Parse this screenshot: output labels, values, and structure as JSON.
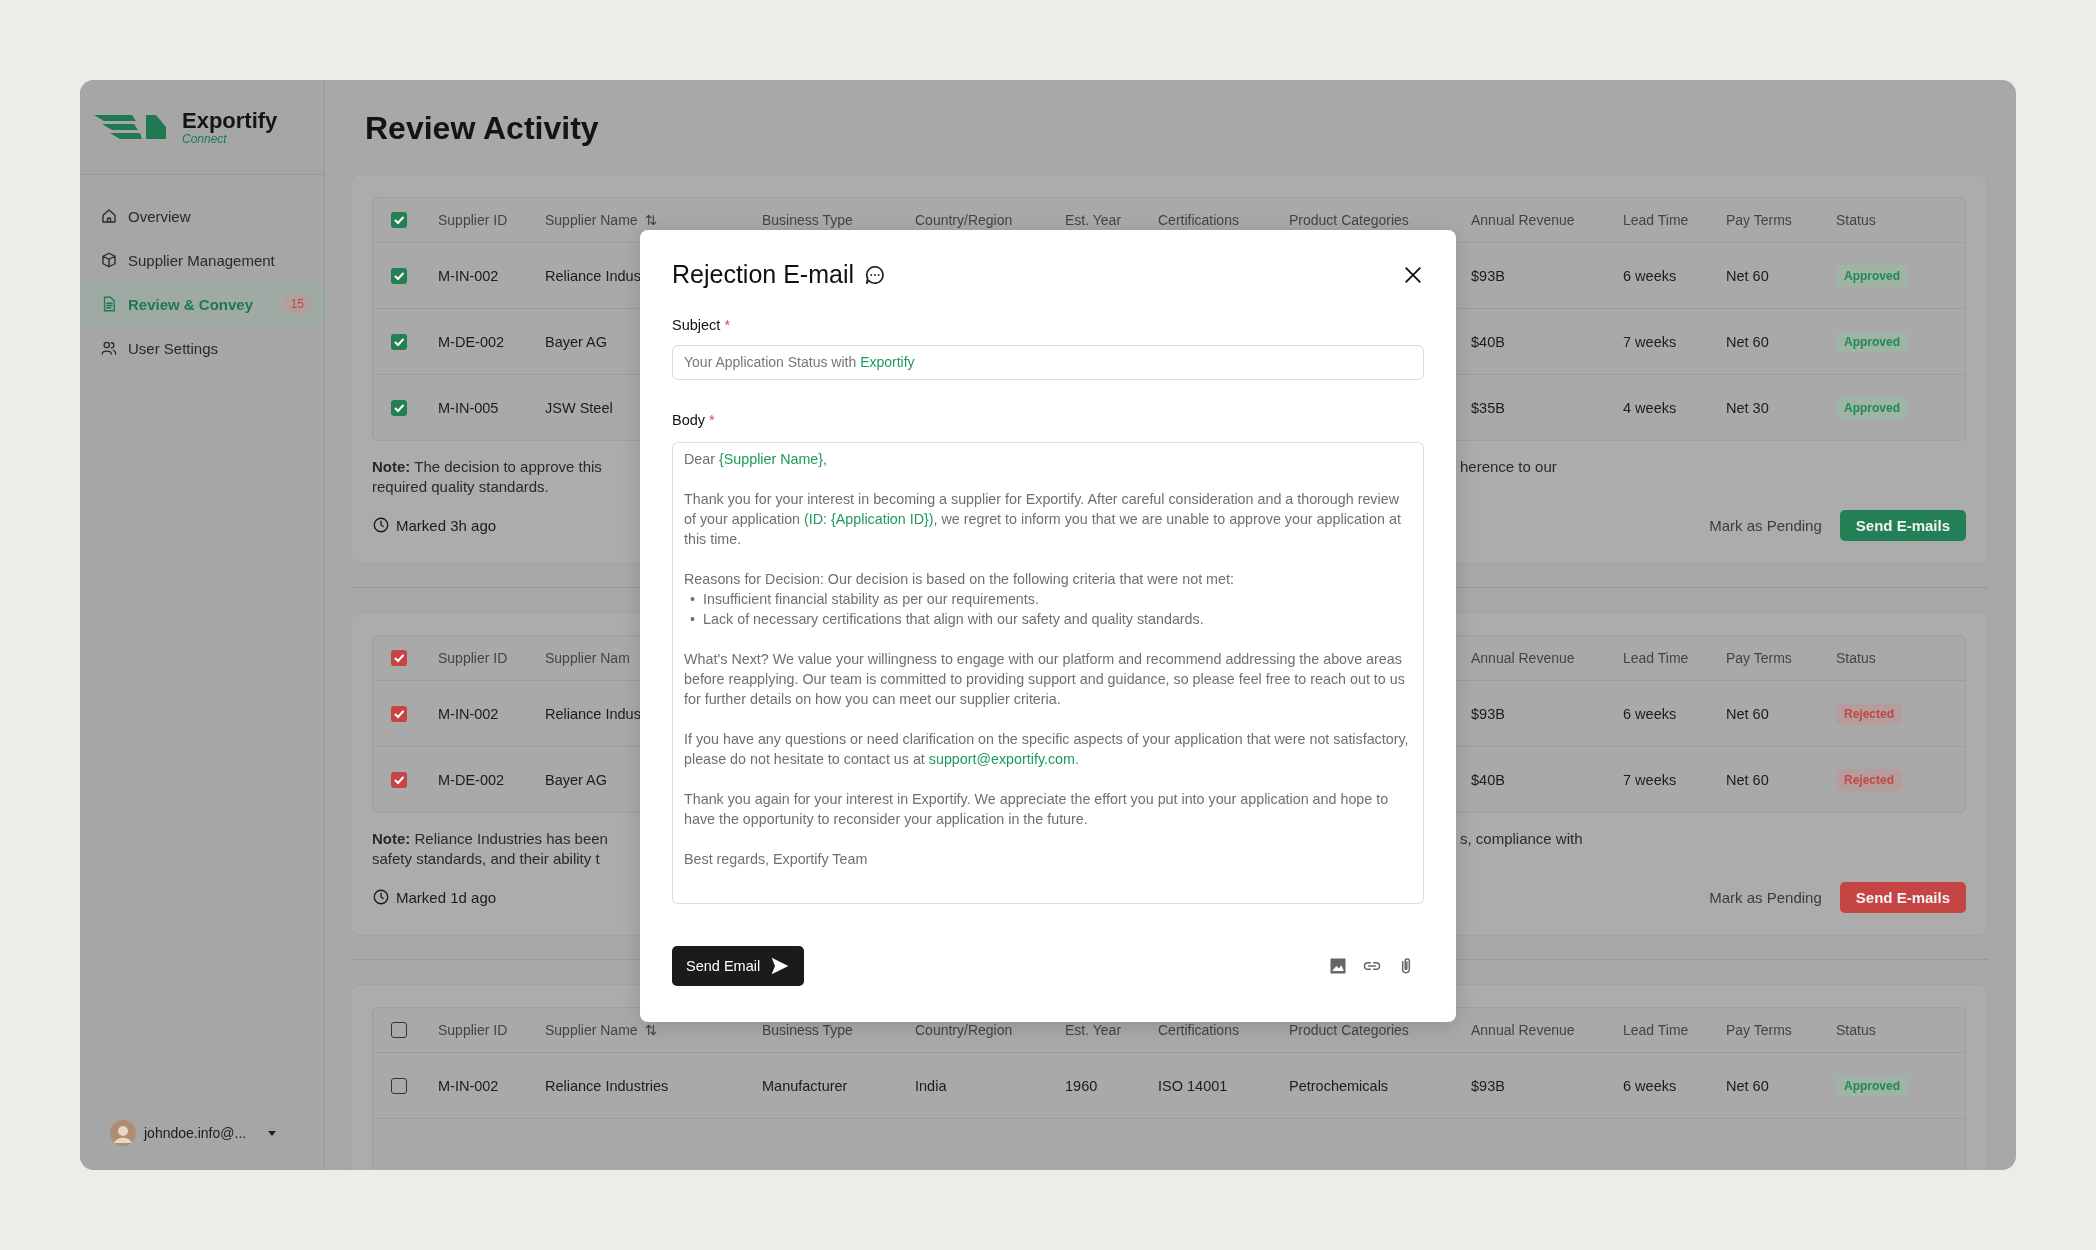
{
  "sidebar": {
    "logo": {
      "name": "Exportify",
      "tagline": "Connect"
    },
    "items": [
      {
        "label": "Overview",
        "selected": false
      },
      {
        "label": "Supplier Management",
        "selected": false
      },
      {
        "label": "Review & Convey",
        "selected": true,
        "badge": "15"
      },
      {
        "label": "User Settings",
        "selected": false
      }
    ],
    "user": {
      "email": "johndoe.info@..."
    }
  },
  "page_title": "Review Activity",
  "sections": [
    {
      "color": "#237f55",
      "header_checked": true,
      "header": {
        "supplier_id": "Supplier ID",
        "supplier_name": {
          "label": "Supplier Name",
          "sortable": true
        },
        "business_type": "Business Type",
        "country": "Country/Region",
        "est_year": "Est. Year",
        "certifications": "Certifications",
        "product_categories": "Product Categories",
        "annual_revenue": "Annual Revenue",
        "lead_time": "Lead Time",
        "pay_terms": "Pay Terms",
        "status": "Status"
      },
      "rows": [
        {
          "checked": true,
          "supplier_id": "M-IN-002",
          "supplier_name": "Reliance Indus",
          "annual_revenue": "$93B",
          "lead_time": "6 weeks",
          "pay_terms": "Net 60",
          "status": {
            "label": "Approved",
            "kind": "approved"
          }
        },
        {
          "checked": true,
          "supplier_id": "M-DE-002",
          "supplier_name": "Bayer AG",
          "annual_revenue": "$40B",
          "lead_time": "7 weeks",
          "pay_terms": "Net 60",
          "status": {
            "label": "Approved",
            "kind": "approved"
          }
        },
        {
          "checked": true,
          "supplier_id": "M-IN-005",
          "supplier_name": "JSW Steel",
          "annual_revenue": "$35B",
          "lead_time": "4 weeks",
          "pay_terms": "Net 30",
          "status": {
            "label": "Approved",
            "kind": "approved"
          }
        }
      ],
      "note": {
        "left_lines": [
          "**Note:** The decision to approve this",
          "required quality standards."
        ],
        "right_lines": [
          "herence to our"
        ]
      },
      "marked": "Marked 3h ago",
      "secondary_button": "Mark as Pending",
      "primary_button": "Send E-mails"
    },
    {
      "color": "#c54444",
      "header_checked": true,
      "header": {
        "supplier_id": "Supplier ID",
        "supplier_name": {
          "label": "Supplier Nam",
          "sortable": false
        },
        "annual_revenue": "Annual Revenue",
        "lead_time": "Lead Time",
        "pay_terms": "Pay Terms",
        "status": "Status"
      },
      "rows": [
        {
          "checked": true,
          "supplier_id": "M-IN-002",
          "supplier_name": "Reliance Indus",
          "annual_revenue": "$93B",
          "lead_time": "6 weeks",
          "pay_terms": "Net 60",
          "status": {
            "label": "Rejected",
            "kind": "rejected"
          }
        },
        {
          "checked": true,
          "supplier_id": "M-DE-002",
          "supplier_name": "Bayer AG",
          "annual_revenue": "$40B",
          "lead_time": "7 weeks",
          "pay_terms": "Net 60",
          "status": {
            "label": "Rejected",
            "kind": "rejected"
          }
        }
      ],
      "note": {
        "left_lines": [
          "**Note:** Reliance Industries has been",
          "safety standards, and their ability t"
        ],
        "right_lines": [
          "s, compliance with"
        ]
      },
      "marked": "Marked 1d ago",
      "secondary_button": "Mark as Pending",
      "primary_button": "Send E-mails"
    },
    {
      "header_checked": false,
      "header": {
        "supplier_id": "Supplier ID",
        "supplier_name": {
          "label": "Supplier Name",
          "sortable": true
        },
        "business_type": "Business Type",
        "country": "Country/Region",
        "est_year": "Est. Year",
        "certifications": "Certifications",
        "product_categories": "Product Categories",
        "annual_revenue": "Annual Revenue",
        "lead_time": "Lead Time",
        "pay_terms": "Pay Terms",
        "status": "Status"
      },
      "rows": [
        {
          "checked": false,
          "supplier_id": "M-IN-002",
          "supplier_name": "Reliance Industries",
          "business_type": "Manufacturer",
          "country": "India",
          "est_year": "1960",
          "certifications": "ISO 14001",
          "product_categories": "Petrochemicals",
          "annual_revenue": "$93B",
          "lead_time": "6 weeks",
          "pay_terms": "Net 60",
          "status": {
            "label": "Approved",
            "kind": "approved"
          }
        }
      ]
    }
  ],
  "modal": {
    "title": "Rejection E-mail",
    "subject": {
      "label": "Subject",
      "required_mark": "*",
      "value": "Your Application Status with **Exportify**"
    },
    "body": {
      "label": "Body",
      "required_mark": "*",
      "paragraphs": [
        {
          "text": "Dear **{Supplier Name}**,"
        },
        {
          "text": "Thank you for your interest in becoming a supplier for Exportify. After careful consideration and a thorough review of your application **(ID: {Application ID})**, we regret to inform you that we are unable to approve your application at this time."
        },
        {
          "text": "Reasons for Decision: Our decision is based on the following criteria that were not met:",
          "bullets": [
            {
              "marker": "•",
              "text": "Insufficient financial stability as per our requirements."
            },
            {
              "marker": "•",
              "text": "Lack of necessary certifications that align with our safety and quality standards."
            }
          ]
        },
        {
          "text": "What’s Next? We value your willingness to engage with our platform and recommend addressing the above areas before reapplying. Our team is committed to providing support and guidance, so please feel free to reach out to us for further details on how you can meet our supplier criteria."
        },
        {
          "text": "If you have any questions or need clarification on the specific aspects of your application that were not satisfactory, please do not hesitate to contact us at ",
          "link": "support@exportify.com",
          "after": "."
        },
        {
          "text": "Thank you again for your interest in Exportify. We appreciate the effort you put into your application and hope to have the opportunity to reconsider your application in the future."
        },
        {
          "text": "Best regards, Exportify Team"
        }
      ]
    },
    "send_button": "Send Email"
  }
}
